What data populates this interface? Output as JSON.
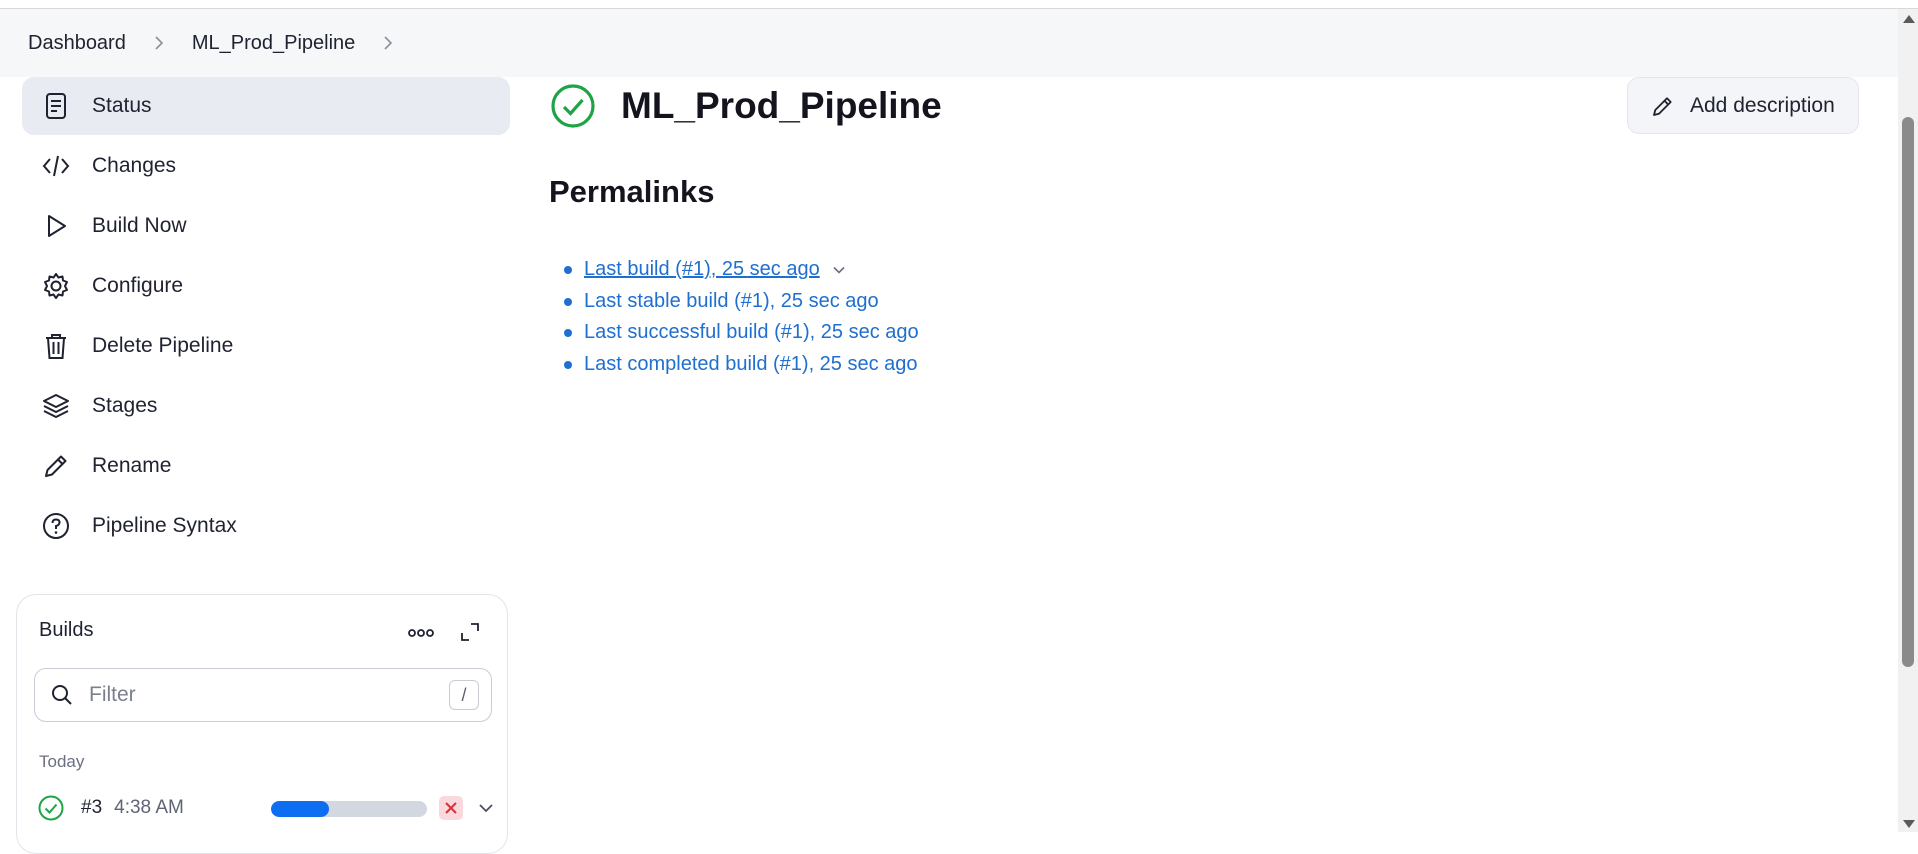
{
  "breadcrumb": {
    "items": [
      "Dashboard",
      "ML_Prod_Pipeline"
    ]
  },
  "sidebar": {
    "items": [
      {
        "label": "Status",
        "icon": "document-icon",
        "active": true
      },
      {
        "label": "Changes",
        "icon": "code-icon"
      },
      {
        "label": "Build Now",
        "icon": "play-icon"
      },
      {
        "label": "Configure",
        "icon": "gear-icon"
      },
      {
        "label": "Delete Pipeline",
        "icon": "trash-icon"
      },
      {
        "label": "Stages",
        "icon": "layers-icon"
      },
      {
        "label": "Rename",
        "icon": "pencil-icon"
      },
      {
        "label": "Pipeline Syntax",
        "icon": "help-circle-icon"
      }
    ]
  },
  "builds": {
    "title": "Builds",
    "filter_placeholder": "Filter",
    "shortcut_key": "/",
    "group_label": "Today",
    "rows": [
      {
        "number": "#3",
        "time": "4:38 AM",
        "progress": 0.37,
        "status": "success"
      }
    ]
  },
  "main": {
    "title": "ML_Prod_Pipeline",
    "status": "success",
    "add_description_label": "Add description",
    "permalinks_heading": "Permalinks",
    "permalinks": [
      "Last build (#1), 25 sec ago",
      "Last stable build (#1), 25 sec ago",
      "Last successful build (#1), 25 sec ago",
      "Last completed build (#1), 25 sec ago"
    ]
  },
  "colors": {
    "success": "#1ea446",
    "link": "#1e6fd0",
    "progress": "#0e6ef2",
    "abort_bg": "#f9d9dc",
    "abort_fg": "#d8303c"
  }
}
